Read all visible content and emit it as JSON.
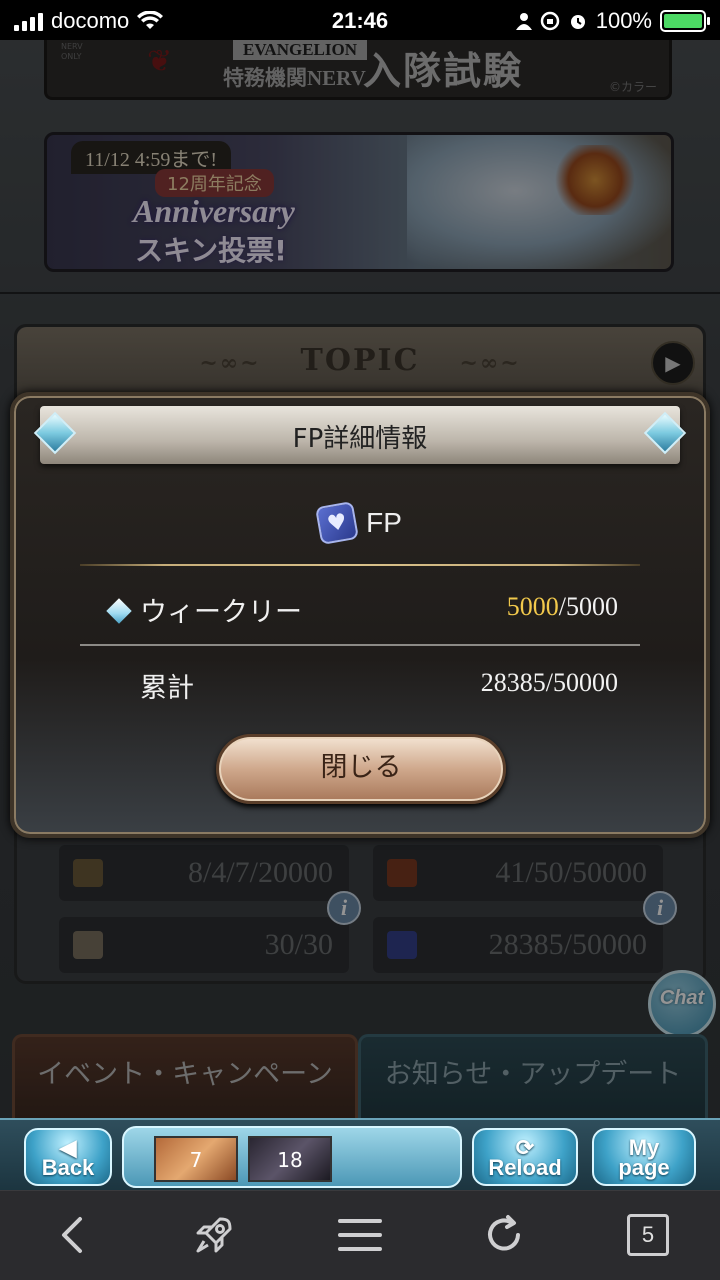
{
  "status_bar": {
    "carrier": "docomo",
    "time": "21:46",
    "battery": "100%"
  },
  "banners": {
    "nerv": {
      "logo": "NERV ONLY",
      "eva": "EVANGELION",
      "sub": "特務機関NERV",
      "title": "入隊試験",
      "copyright": "©カラー"
    },
    "anniversary": {
      "date": "11/12 4:59まで!",
      "ribbon": "12周年記念",
      "word": "Anniversary",
      "sub": "スキン投票!"
    }
  },
  "topic": {
    "title": "TOPIC",
    "stats": [
      {
        "value": "8/4/7/20000"
      },
      {
        "value": "41/50/50000"
      },
      {
        "value": "30/30"
      },
      {
        "value": "28385/50000"
      }
    ]
  },
  "chat_label": "Chat",
  "tabs": {
    "event": "イベント・キャンペーン",
    "news": "お知らせ・アップデート"
  },
  "popup": {
    "title": "FP詳細情報",
    "section_label": "FP",
    "weekly": {
      "label": "ウィークリー",
      "current": "5000",
      "max": "/5000"
    },
    "total": {
      "label": "累計",
      "value": "28385/50000"
    },
    "close_label": "閉じる"
  },
  "game_nav": {
    "back": "Back",
    "reload": "Reload",
    "mypage_1": "My",
    "mypage_2": "page",
    "slot_1": "7",
    "slot_2": "18"
  },
  "browser_toolbar": {
    "tab_count": "5"
  },
  "colors": {
    "accent_gold": "#f2c94c",
    "gem_blue": "#7ccae0",
    "battery_green": "#4cd964"
  }
}
